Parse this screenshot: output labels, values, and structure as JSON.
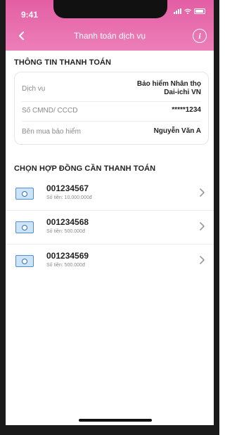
{
  "status_bar": {
    "time": "9:41"
  },
  "header": {
    "title": "Thanh toán dịch vụ"
  },
  "payment_info": {
    "section_title": "THÔNG TIN THANH TOÁN",
    "rows": [
      {
        "label": "Dịch vụ",
        "value_line1": "Bảo hiểm Nhân thọ",
        "value_line2": "Dai-ichi VN"
      },
      {
        "label": "Số CMND/ CCCD",
        "value": "*****1234"
      },
      {
        "label": "Bên mua bảo hiểm",
        "value": "Nguyễn Văn A"
      }
    ]
  },
  "contracts": {
    "section_title": "CHỌN HỢP ĐỒNG CẦN THANH TOÁN",
    "items": [
      {
        "number": "001234567",
        "amount": "Số tiền: 10.000.000đ"
      },
      {
        "number": "001234568",
        "amount": "Số tiền: 500.000đ"
      },
      {
        "number": "001234569",
        "amount": "Số tiền: 500.000đ"
      }
    ]
  },
  "icons": {
    "back": "chevron-left-icon",
    "info": "info-icon",
    "contract": "money-icon",
    "row_action": "chevron-right-icon"
  },
  "colors": {
    "header_start": "#e35ea4",
    "header_end": "#ec7fb8",
    "icon_blue": "#4a90d9"
  }
}
